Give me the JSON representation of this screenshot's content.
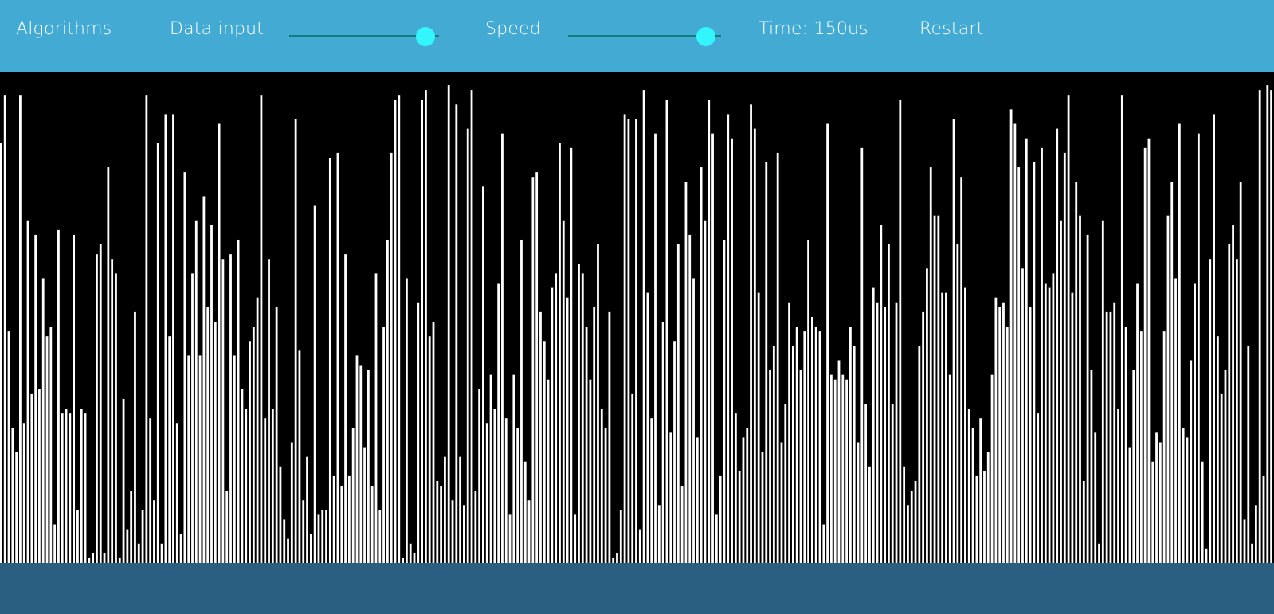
{
  "nav": {
    "algorithms_label": "Algorithms",
    "data_input_label": "Data input",
    "speed_label": "Speed",
    "time_label": "Time: 150us",
    "restart_label": "Restart"
  },
  "sliders": {
    "data_input": {
      "value": 0.91
    },
    "speed": {
      "value": 0.9
    }
  },
  "colors": {
    "topbar": "#43abd3",
    "footer": "#2a5f82",
    "stage": "#000000",
    "bar": "#ffffff",
    "slider_track": "#137f7b",
    "slider_thumb": "#33f5fc"
  },
  "chart_data": {
    "type": "bar",
    "ylim": [
      0,
      1
    ],
    "values": [
      0.87,
      0.97,
      0.48,
      0.28,
      0.23,
      0.97,
      0.29,
      0.71,
      0.35,
      0.68,
      0.36,
      0.59,
      0.47,
      0.49,
      0.08,
      0.69,
      0.31,
      0.32,
      0.31,
      0.68,
      0.11,
      0.32,
      0.31,
      0.01,
      0.02,
      0.64,
      0.66,
      0.02,
      0.82,
      0.63,
      0.6,
      0.01,
      0.34,
      0.07,
      0.15,
      0.52,
      0.04,
      0.11,
      0.97,
      0.3,
      0.13,
      0.87,
      0.04,
      0.93,
      0.47,
      0.93,
      0.29,
      0.06,
      0.81,
      0.43,
      0.6,
      0.71,
      0.43,
      0.76,
      0.53,
      0.7,
      0.5,
      0.91,
      0.63,
      0.15,
      0.64,
      0.43,
      0.67,
      0.36,
      0.32,
      0.46,
      0.49,
      0.55,
      0.97,
      0.3,
      0.63,
      0.32,
      0.53,
      0.2,
      0.09,
      0.05,
      0.25,
      0.92,
      0.44,
      0.13,
      0.22,
      0.06,
      0.74,
      0.1,
      0.11,
      0.11,
      0.84,
      0.18,
      0.85,
      0.16,
      0.64,
      0.18,
      0.28,
      0.43,
      0.41,
      0.24,
      0.4,
      0.16,
      0.6,
      0.11,
      0.49,
      0.67,
      0.85,
      0.96,
      0.97,
      0.01,
      0.59,
      0.04,
      0.02,
      0.54,
      0.96,
      0.98,
      0.47,
      0.5,
      0.17,
      0.16,
      0.22,
      0.99,
      0.13,
      0.95,
      0.22,
      0.12,
      0.9,
      0.98,
      0.15,
      0.36,
      0.78,
      0.29,
      0.39,
      0.32,
      0.58,
      0.89,
      0.3,
      0.1,
      0.39,
      0.28,
      0.67,
      0.21,
      0.13,
      0.8,
      0.81,
      0.52,
      0.46,
      0.38,
      0.57,
      0.6,
      0.87,
      0.71,
      0.55,
      0.86,
      0.1,
      0.62,
      0.6,
      0.49,
      0.38,
      0.53,
      0.66,
      0.32,
      0.28,
      0.52,
      0.01,
      0.02,
      0.11,
      0.93,
      0.92,
      0.35,
      0.92,
      0.07,
      0.98,
      0.56,
      0.3,
      0.89,
      0.12,
      0.5,
      0.96,
      0.27,
      0.46,
      0.66,
      0.16,
      0.79,
      0.68,
      0.59,
      0.26,
      0.82,
      0.71,
      0.96,
      0.89,
      0.1,
      0.18,
      0.67,
      0.93,
      0.88,
      0.31,
      0.19,
      0.26,
      0.28,
      0.95,
      0.9,
      0.56,
      0.23,
      0.83,
      0.4,
      0.45,
      0.85,
      0.25,
      0.33,
      0.54,
      0.45,
      0.49,
      0.4,
      0.48,
      0.67,
      0.51,
      0.49,
      0.48,
      0.08,
      0.91,
      0.39,
      0.38,
      0.42,
      0.39,
      0.38,
      0.49,
      0.45,
      0.25,
      0.86,
      0.33,
      0.2,
      0.57,
      0.54,
      0.7,
      0.53,
      0.66,
      0.33,
      0.54,
      0.96,
      0.2,
      0.12,
      0.15,
      0.17,
      0.45,
      0.52,
      0.61,
      0.82,
      0.72,
      0.72,
      0.56,
      0.56,
      0.39,
      0.92,
      0.66,
      0.8,
      0.57,
      0.32,
      0.28,
      0.18,
      0.3,
      0.19,
      0.23,
      0.39,
      0.55,
      0.53,
      0.54,
      0.49,
      0.94,
      0.91,
      0.82,
      0.61,
      0.88,
      0.53,
      0.83,
      0.31,
      0.86,
      0.58,
      0.57,
      0.6,
      0.9,
      0.71,
      0.85,
      0.97,
      0.56,
      0.79,
      0.72,
      0.17,
      0.68,
      0.4,
      0.27,
      0.04,
      0.71,
      0.52,
      0.52,
      0.54,
      0.32,
      0.97,
      0.49,
      0.24,
      0.4,
      0.58,
      0.48,
      0.86,
      0.88,
      0.21,
      0.27,
      0.25,
      0.48,
      0.72,
      0.79,
      0.59,
      0.91,
      0.28,
      0.26,
      0.42,
      0.58,
      0.89,
      0.21,
      0.03,
      0.63,
      0.93,
      0.47,
      0.35,
      0.4,
      0.66,
      0.7,
      0.63,
      0.79,
      0.09,
      0.45,
      0.04,
      0.12,
      0.98,
      0.18,
      0.99,
      0.98
    ]
  }
}
